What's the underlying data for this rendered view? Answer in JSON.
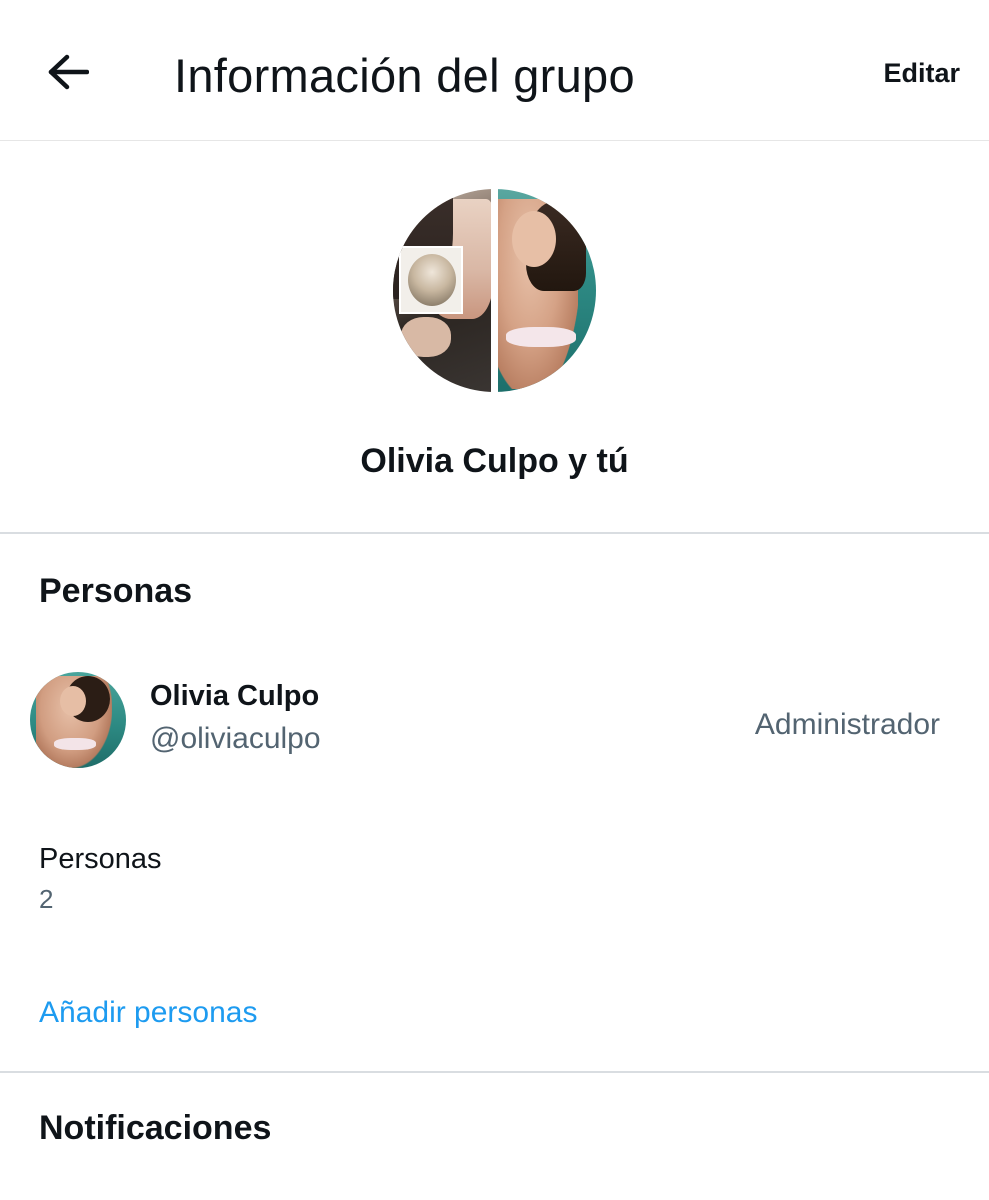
{
  "header": {
    "back_icon": "arrow-left-icon",
    "title": "Información del grupo",
    "edit_label": "Editar"
  },
  "group": {
    "name": "Olivia Culpo y tú"
  },
  "people_section": {
    "title": "Personas",
    "members": [
      {
        "name": "Olivia Culpo",
        "handle": "@oliviaculpo",
        "role": "Administrador"
      }
    ],
    "count_label": "Personas",
    "count_value": "2",
    "add_label": "Añadir personas"
  },
  "notifications_section": {
    "title": "Notificaciones"
  },
  "colors": {
    "text_primary": "#0f1419",
    "text_secondary": "#536471",
    "accent": "#1d9bf0",
    "divider": "#d9dde1"
  }
}
